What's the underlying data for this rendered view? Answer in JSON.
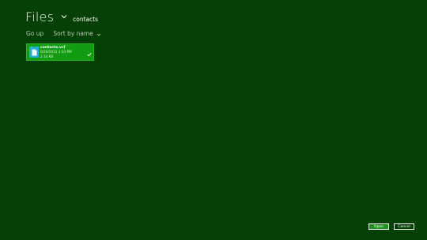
{
  "header": {
    "title": "Files",
    "location": "contacts"
  },
  "commands": {
    "go_up": "Go up",
    "sort": "Sort by name"
  },
  "files": [
    {
      "name": "contacts.vcf",
      "date": "6/20/2012 3:33 PM",
      "size": "2.14 KB",
      "selected": true,
      "icon": "document-icon"
    }
  ],
  "footer": {
    "open_label": "Open",
    "cancel_label": "Cancel"
  },
  "colors": {
    "background": "#043f04",
    "tile": "#119c11",
    "file_icon": "#23b1d6"
  }
}
